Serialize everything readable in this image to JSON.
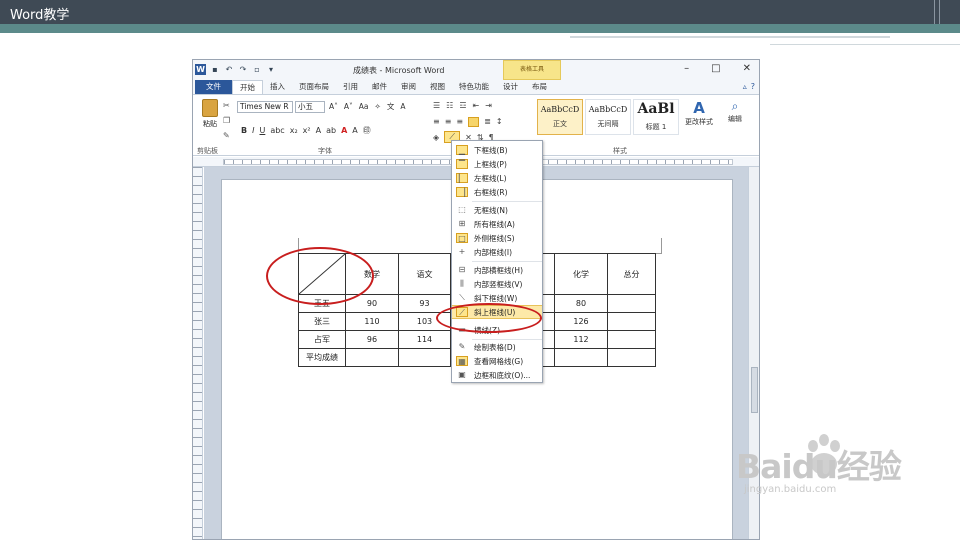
{
  "slide": {
    "title": "Word教学"
  },
  "window": {
    "title": "成绩表 - Microsoft Word",
    "context_tab": "表格工具"
  },
  "tabs": [
    "文件",
    "开始",
    "插入",
    "页面布局",
    "引用",
    "邮件",
    "审阅",
    "视图",
    "特色功能",
    "设计",
    "布局"
  ],
  "active_tab": "开始",
  "ribbon": {
    "paste_label": "粘贴",
    "font_name": "Times New R",
    "font_size": "小五",
    "group_labels": {
      "clipboard": "剪贴板",
      "font": "字体",
      "styles": "样式"
    },
    "styles": [
      {
        "sample": "AaBbCcD",
        "name": "正文"
      },
      {
        "sample": "AaBbCcD",
        "name": "无间隔"
      },
      {
        "sample": "AaBl",
        "name": "标题 1"
      }
    ],
    "change_styles": "更改样式",
    "editing": "编辑"
  },
  "table": {
    "headers": [
      "",
      "数学",
      "语文",
      "",
      "",
      "化学",
      "总分"
    ],
    "rows": [
      {
        "name": "王五",
        "cells": [
          "90",
          "93",
          "",
          "",
          "80",
          ""
        ]
      },
      {
        "name": "张三",
        "cells": [
          "110",
          "103",
          "",
          "",
          "126",
          ""
        ]
      },
      {
        "name": "占军",
        "cells": [
          "96",
          "114",
          "",
          "",
          "112",
          ""
        ]
      },
      {
        "name": "平均成绩",
        "cells": [
          "",
          "",
          "",
          "",
          "",
          ""
        ]
      }
    ]
  },
  "border_menu": [
    {
      "label": "下框线(B)",
      "icon": "bottom-border-icon"
    },
    {
      "label": "上框线(P)",
      "icon": "top-border-icon"
    },
    {
      "label": "左框线(L)",
      "icon": "left-border-icon"
    },
    {
      "label": "右框线(R)",
      "icon": "right-border-icon"
    },
    {
      "label": "无框线(N)",
      "icon": "no-border-icon"
    },
    {
      "label": "所有框线(A)",
      "icon": "all-borders-icon"
    },
    {
      "label": "外侧框线(S)",
      "icon": "outside-borders-icon"
    },
    {
      "label": "内部框线(I)",
      "icon": "inside-borders-icon"
    },
    {
      "label": "内部横框线(H)",
      "icon": "inside-horizontal-border-icon"
    },
    {
      "label": "内部竖框线(V)",
      "icon": "inside-vertical-border-icon"
    },
    {
      "label": "斜下框线(W)",
      "icon": "diagonal-down-border-icon"
    },
    {
      "label": "斜上框线(U)",
      "icon": "diagonal-up-border-icon"
    },
    {
      "label": "横线(Z)",
      "icon": "horizontal-line-icon"
    },
    {
      "label": "绘制表格(D)",
      "icon": "draw-table-icon"
    },
    {
      "label": "查看网格线(G)",
      "icon": "view-gridlines-icon"
    },
    {
      "label": "边框和底纹(O)...",
      "icon": "borders-shading-icon"
    }
  ],
  "highlighted_menu_item": "斜上框线(U)",
  "watermark": {
    "main": "Baidu经验",
    "sub": "jingyan.baidu.com"
  },
  "colors": {
    "accent": "#2b579a",
    "highlight": "#fde9a8",
    "annotation": "#c81e1e",
    "slide_bar": "#3f4a55"
  }
}
